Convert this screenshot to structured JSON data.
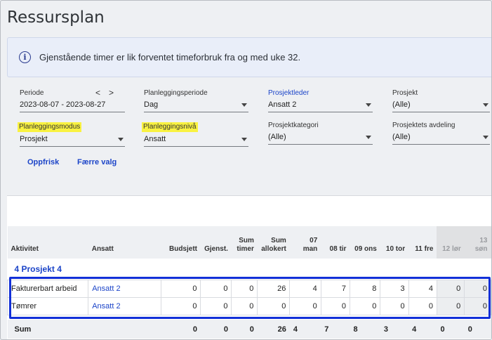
{
  "page_title": "Ressursplan",
  "info": {
    "icon": "info-icon",
    "text": "Gjenstående timer er lik forventet timeforbruk fra og med uke 32."
  },
  "filters": {
    "periode": {
      "label": "Periode",
      "value": "2023-08-07 - 2023-08-27",
      "prev": "<",
      "next": ">"
    },
    "planleggingsperiode": {
      "label": "Planleggingsperiode",
      "value": "Dag"
    },
    "prosjektleder": {
      "label": "Prosjektleder",
      "value": "Ansatt 2"
    },
    "prosjekt": {
      "label": "Prosjekt",
      "value": "(Alle)"
    },
    "planleggingsmodus": {
      "label": "Planleggingsmodus",
      "value": "Prosjekt"
    },
    "planleggingsniva": {
      "label": "Planleggingsnivå",
      "value": "Ansatt"
    },
    "prosjektkategori": {
      "label": "Prosjektkategori",
      "value": "(Alle)"
    },
    "prosjektets_avdeling": {
      "label": "Prosjektets avdeling",
      "value": "(Alle)"
    }
  },
  "actions": {
    "refresh": "Oppfrisk",
    "fewer_options": "Færre valg"
  },
  "table": {
    "headers": {
      "aktivitet": "Aktivitet",
      "ansatt": "Ansatt",
      "budsjett": "Budsjett",
      "gjenst": "Gjenst.",
      "sum_timer_1": "Sum",
      "sum_timer_2": "timer",
      "sum_allokert_1": "Sum",
      "sum_allokert_2": "allokert",
      "d07": "07 man",
      "d08": "08 tir",
      "d09": "09 ons",
      "d10": "10 tor",
      "d11": "11 fre",
      "d12": "12 lør",
      "d13": "13 søn"
    },
    "group": "4 Prosjekt 4",
    "rows": [
      {
        "aktivitet": "Fakturerbart arbeid",
        "ansatt": "Ansatt 2",
        "budsjett": "0",
        "gjenst": "0",
        "sum_timer": "0",
        "sum_allokert": "26",
        "d07": "4",
        "d08": "7",
        "d09": "8",
        "d10": "3",
        "d11": "4",
        "d12": "0",
        "d13": "0"
      },
      {
        "aktivitet": "Tømrer",
        "ansatt": "Ansatt 2",
        "budsjett": "0",
        "gjenst": "0",
        "sum_timer": "0",
        "sum_allokert": "0",
        "d07": "0",
        "d08": "0",
        "d09": "0",
        "d10": "0",
        "d11": "0",
        "d12": "0",
        "d13": "0"
      }
    ],
    "sum": {
      "label": "Sum",
      "budsjett": "0",
      "gjenst": "0",
      "sum_timer": "0",
      "sum_allokert": "26",
      "d07": "4",
      "d08": "7",
      "d09": "8",
      "d10": "3",
      "d11": "4",
      "d12": "0",
      "d13": "0"
    }
  },
  "colors": {
    "accent": "#1b44c8",
    "highlight": "#f9f241",
    "selection": "#1230d8"
  }
}
